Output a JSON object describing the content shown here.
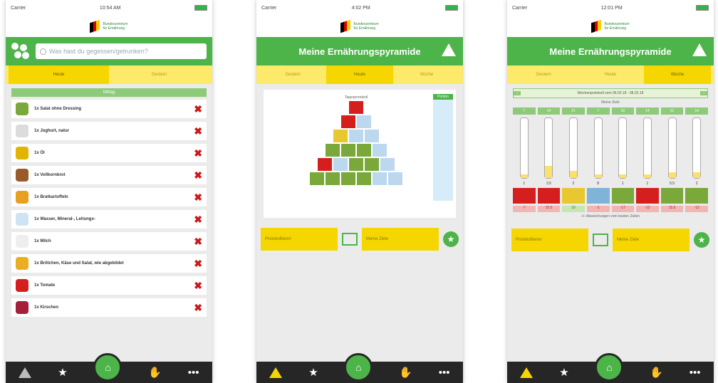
{
  "screens": [
    {
      "status": {
        "carrier": "Carrier",
        "time": "10:54 AM"
      },
      "logo": {
        "line1": "Bundeszentrum",
        "line2": "für Ernährung"
      },
      "search": {
        "placeholder": "Was hast du gegessen/getrunken?"
      },
      "tabs": [
        "Heute",
        "Gestern"
      ],
      "section": "Mittag",
      "items": [
        {
          "title": "1x Salat ohne Dressing",
          "color": "#7aa83a"
        },
        {
          "title": "1x Joghurt, natur",
          "color": "#dcdcdc"
        },
        {
          "title": "1x Öl",
          "color": "#e0b400"
        },
        {
          "title": "1x Vollkornbrot",
          "color": "#9b5a2a"
        },
        {
          "title": "1x Bratkartoffeln",
          "color": "#e8a020"
        },
        {
          "title": "1x Wasser, Mineral-, Leitungs-",
          "color": "#cfe4f2"
        },
        {
          "title": "1x Milch",
          "color": "#eeeeee"
        },
        {
          "title": "1x Brötchen, Käse und Salat, wie abgebildet",
          "color": "#e8b020"
        },
        {
          "title": "1x Tomate",
          "color": "#d51f1f"
        },
        {
          "title": "1x Kirschen",
          "color": "#a4203a"
        }
      ]
    },
    {
      "status": {
        "carrier": "Carrier",
        "time": "4:02 PM"
      },
      "logo": {
        "line1": "Bundeszentrum",
        "line2": "für Ernährung"
      },
      "title": "Meine Ernährungspyramide",
      "tabs": [
        "Gestern",
        "Heute",
        "Woche"
      ],
      "pyramid_label": "Tagesprotokoll",
      "side_label": "Portion",
      "actions": [
        "Protokollieren",
        "Meine Ziele"
      ]
    },
    {
      "status": {
        "carrier": "Carrier",
        "time": "12:01 PM"
      },
      "logo": {
        "line1": "Bundeszentrum",
        "line2": "für Ernährung"
      },
      "title": "Meine Ernährungspyramide",
      "tabs": [
        "Gestern",
        "Heute",
        "Woche"
      ],
      "date_range": "Wochenprotokoll vom 06.02.18 - 08.02.18",
      "subtitle": "Meine Ziele",
      "columns": [
        {
          "target": "7",
          "actual": "1",
          "diff": "-7",
          "color": "#d51f1f",
          "level": 0.06
        },
        {
          "target": "14",
          "actual": "3.5",
          "diff": "10.5",
          "color": "#d51f1f",
          "level": 0.2
        },
        {
          "target": "21",
          "actual": "2",
          "diff": "19",
          "color": "#e8c830",
          "level": 0.12,
          "positive": true
        },
        {
          "target": "7",
          "actual": "8",
          "diff": "-1",
          "color": "#7fb4d8",
          "level": 0.06
        },
        {
          "target": "18",
          "actual": "1",
          "diff": "-17",
          "color": "#7aa83a",
          "level": 0.06
        },
        {
          "target": "14",
          "actual": "1",
          "diff": "-13",
          "color": "#d51f1f",
          "level": 0.06
        },
        {
          "target": "21",
          "actual": "5.5",
          "diff": "15.5",
          "color": "#7aa83a",
          "level": 0.1
        },
        {
          "target": "14",
          "actual": "2",
          "diff": "-12",
          "color": "#7aa83a",
          "level": 0.1
        }
      ],
      "note": "+/- Abweichungen vom besten Zielen",
      "actions": [
        "Protokollieren",
        "Meine Ziele"
      ]
    }
  ],
  "nav": {
    "star": "★",
    "home": "⌂",
    "hand": "✋",
    "more": "•••"
  }
}
